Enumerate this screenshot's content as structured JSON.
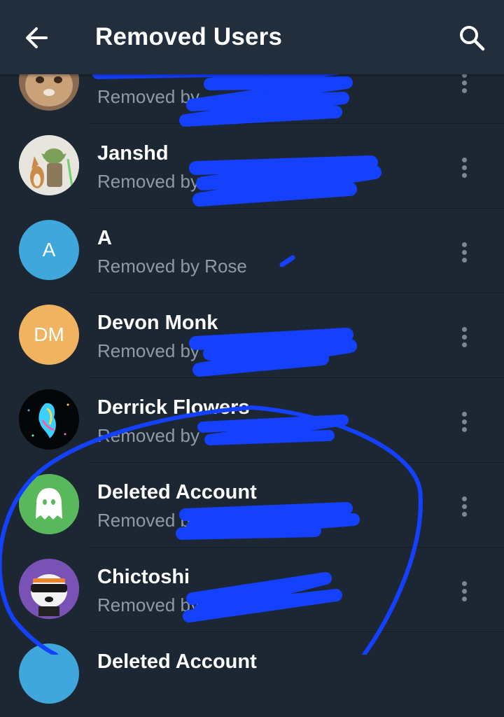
{
  "header": {
    "title": "Removed Users",
    "back_icon": "arrow-left-icon",
    "search_icon": "search-icon"
  },
  "users": [
    {
      "name": "",
      "subtitle": "Removed by"
    },
    {
      "name": "Janshd",
      "subtitle": "Removed by"
    },
    {
      "name": "A",
      "subtitle": "Removed by Rose",
      "avatar_initials": "A",
      "avatar_color": "#3fa7db"
    },
    {
      "name": "Devon Monk",
      "subtitle": "Removed by",
      "avatar_initials": "DM",
      "avatar_color": "#f0b35f"
    },
    {
      "name": "Derrick Flowers",
      "subtitle": "Removed by"
    },
    {
      "name": "Deleted Account",
      "subtitle": "Removed by",
      "avatar_color": "#59b85c"
    },
    {
      "name": "Chictoshi",
      "subtitle": "Removed by",
      "avatar_color": "#7a52b5"
    },
    {
      "name": "Deleted Account",
      "subtitle": ""
    }
  ],
  "colors": {
    "background": "#1d2733",
    "app_bar": "#232e3c",
    "secondary_text": "#8e9aa8",
    "scribble": "#1440ff"
  }
}
